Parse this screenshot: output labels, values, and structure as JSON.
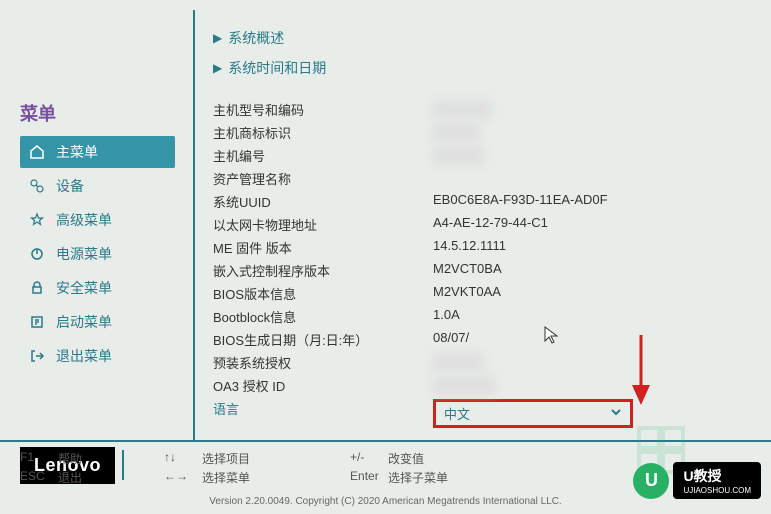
{
  "sidebar": {
    "title": "菜单",
    "items": [
      {
        "label": "主菜单",
        "icon": "home"
      },
      {
        "label": "设备",
        "icon": "devices"
      },
      {
        "label": "高级菜单",
        "icon": "advanced"
      },
      {
        "label": "电源菜单",
        "icon": "power"
      },
      {
        "label": "安全菜单",
        "icon": "security"
      },
      {
        "label": "启动菜单",
        "icon": "boot"
      },
      {
        "label": "退出菜单",
        "icon": "exit"
      }
    ]
  },
  "logo": "Lenovo",
  "sections": [
    {
      "label": "系统概述"
    },
    {
      "label": "系统时间和日期"
    }
  ],
  "info": [
    {
      "label": "主机型号和编码",
      "value": ""
    },
    {
      "label": "主机商标标识",
      "value": ""
    },
    {
      "label": "主机编号",
      "value": ""
    },
    {
      "label": "资产管理名称",
      "value": ""
    },
    {
      "label": "系统UUID",
      "value": "EB0C6E8A-F93D-11EA-AD0F"
    },
    {
      "label": "以太网卡物理地址",
      "value": "A4-AE-12-79-44-C1"
    },
    {
      "label": "ME 固件 版本",
      "value": "14.5.12.1111"
    },
    {
      "label": "嵌入式控制程序版本",
      "value": "M2VCT0BA"
    },
    {
      "label": "BIOS版本信息",
      "value": "M2VKT0AA"
    },
    {
      "label": "Bootblock信息",
      "value": "1.0A"
    },
    {
      "label": "BIOS生成日期（月:日:年）",
      "value": "08/07/"
    },
    {
      "label": "预装系统授权",
      "value": ""
    },
    {
      "label": "OA3 授权 ID",
      "value": ""
    }
  ],
  "language": {
    "label": "语言",
    "value": "中文"
  },
  "footer": {
    "col1": [
      {
        "key": "F1",
        "label": "帮助"
      },
      {
        "key": "ESC",
        "label": "退出"
      }
    ],
    "col2": [
      {
        "key": "↑↓",
        "label": "选择项目"
      },
      {
        "key": "←→",
        "label": "选择菜单"
      }
    ],
    "col3": [
      {
        "key": "+/-",
        "label": "改变值"
      },
      {
        "key": "Enter",
        "label": "选择子菜单"
      }
    ]
  },
  "copyright": "Version 2.20.0049. Copyright (C) 2020 American Megatrends International LLC.",
  "watermark": {
    "badge": "U",
    "title": "U教授",
    "sub": "UJIAOSHOU.COM"
  }
}
